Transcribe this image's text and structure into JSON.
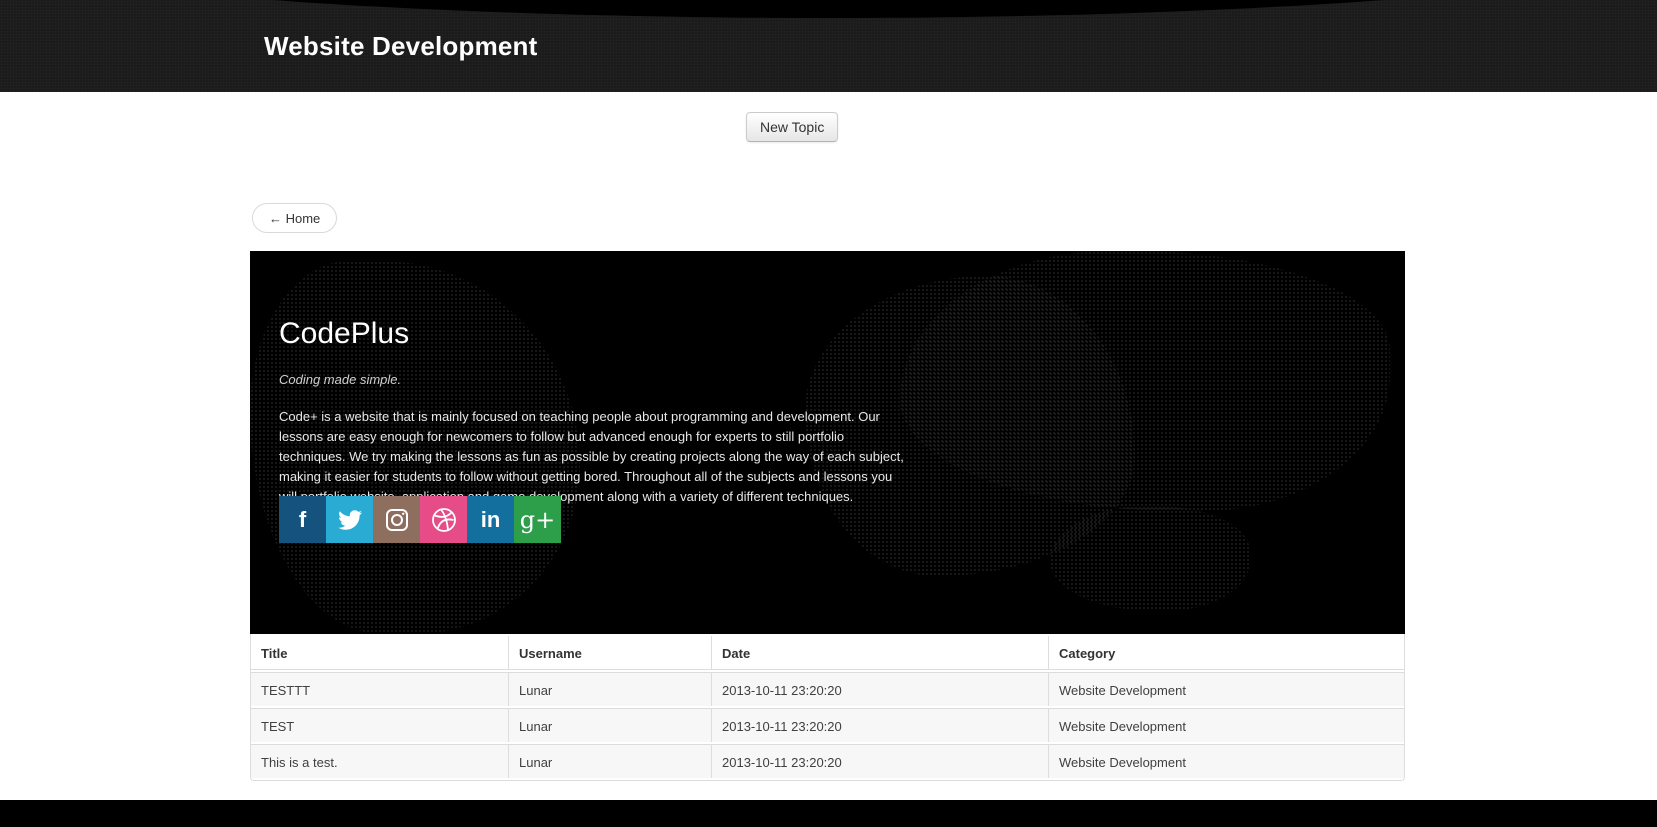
{
  "header": {
    "title": "Website Development"
  },
  "toolbar": {
    "new_topic_label": "New Topic"
  },
  "nav": {
    "home_label": "← Home"
  },
  "hero": {
    "title": "CodePlus",
    "tagline": "Coding made simple.",
    "description": "Code+ is a website that is mainly focused on teaching people about programming and development. Our lessons are easy enough for newcomers to follow but advanced enough for experts to still portfolio techniques. We try making the lessons as fun as possible by creating projects along the way of each subject, making it easier for students to follow without getting bored. Throughout all of the subjects and lessons you will portfolio website, application and game development along with a variety of different techniques.",
    "social": [
      {
        "name": "facebook",
        "color": "#16527e"
      },
      {
        "name": "twitter",
        "color": "#2aabd4"
      },
      {
        "name": "instagram",
        "color": "#8d6e5f"
      },
      {
        "name": "dribbble",
        "color": "#e64c88"
      },
      {
        "name": "linkedin",
        "color": "#13709e"
      },
      {
        "name": "googleplus",
        "color": "#2d9e49"
      }
    ],
    "linkedin_glyph": "in",
    "googleplus_glyph": "g+",
    "facebook_glyph": "f"
  },
  "table": {
    "columns": [
      "Title",
      "Username",
      "Date",
      "Category"
    ],
    "rows": [
      {
        "title": "TESTTT",
        "username": "Lunar",
        "date": "2013-10-11 23:20:20",
        "category": "Website Development"
      },
      {
        "title": "TEST",
        "username": "Lunar",
        "date": "2013-10-11 23:20:20",
        "category": "Website Development"
      },
      {
        "title": "This is a test.",
        "username": "Lunar",
        "date": "2013-10-11 23:20:20",
        "category": "Website Development"
      }
    ]
  },
  "colors": {
    "header_bg": "#191919",
    "footer_bg": "#000000",
    "hero_bg": "#000000",
    "row_bg": "#f7f7f7",
    "table_border": "#dddddd"
  }
}
